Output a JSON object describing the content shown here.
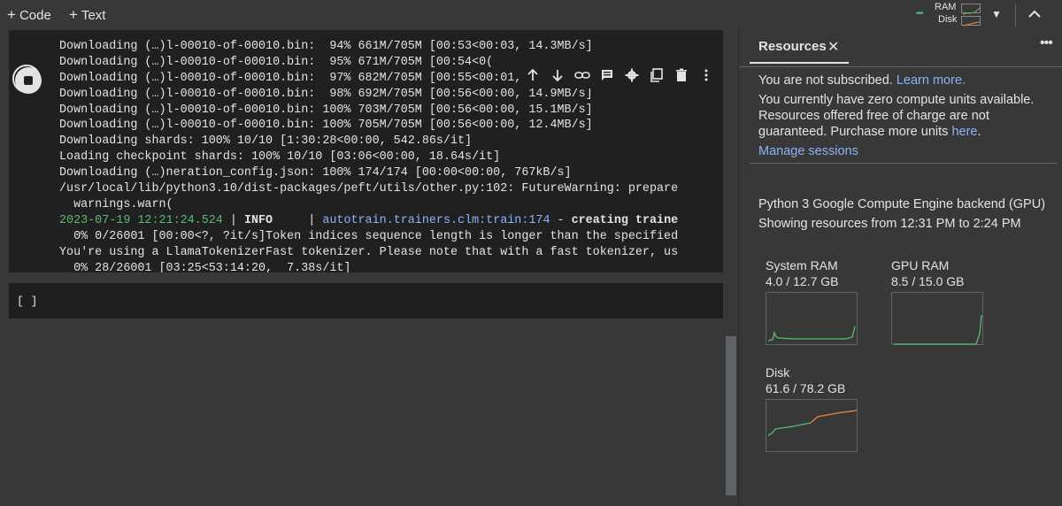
{
  "toolbar": {
    "code_label": "Code",
    "text_label": "Text",
    "ram_label": "RAM",
    "disk_label": "Disk"
  },
  "output": {
    "lines": [
      "Downloading (…)l-00010-of-00010.bin:  94% 661M/705M [00:53<00:03, 14.3MB/s]",
      "Downloading (…)l-00010-of-00010.bin:  95% 671M/705M [00:54<0(",
      "Downloading (…)l-00010-of-00010.bin:  97% 682M/705M [00:55<00:01, 14.4MB/s]",
      "Downloading (…)l-00010-of-00010.bin:  98% 692M/705M [00:56<00:00, 14.9MB/s]",
      "Downloading (…)l-00010-of-00010.bin: 100% 703M/705M [00:56<00:00, 15.1MB/s]",
      "Downloading (…)l-00010-of-00010.bin: 100% 705M/705M [00:56<00:00, 12.4MB/s]",
      "Downloading shards: 100% 10/10 [1:30:28<00:00, 542.86s/it]",
      "Loading checkpoint shards: 100% 10/10 [03:06<00:00, 18.64s/it]",
      "Downloading (…)neration_config.json: 100% 174/174 [00:00<00:00, 767kB/s]",
      "/usr/local/lib/python3.10/dist-packages/peft/utils/other.py:102: FutureWarning: prepare",
      "  warnings.warn("
    ],
    "log_ts": "2023-07-19 12:21:24.524",
    "log_sep1": " | ",
    "log_level": "INFO",
    "log_sep2": "     | ",
    "log_module": "autotrain.trainers.clm:train:174",
    "log_dash": " - ",
    "log_msg": "creating traine",
    "tail": [
      "  0% 0/26001 [00:00<?, ?it/s]Token indices sequence length is longer than the specified",
      "You're using a LlamaTokenizerFast tokenizer. Please note that with a fast tokenizer, us",
      "  0% 28/26001 [03:25<53:14:20,  7.38s/it]"
    ]
  },
  "empty_cell": {
    "brackets": "[ ]"
  },
  "panel": {
    "title": "Resources",
    "not_subscribed": "You are not subscribed.",
    "learn_more": "Learn more.",
    "zero_units_1": "You currently have zero compute units available.",
    "zero_units_2": "Resources offered free of charge are not",
    "zero_units_3": "guaranteed. Purchase more units",
    "here": "here",
    "manage_sessions": "Manage sessions",
    "backend": "Python 3 Google Compute Engine backend (GPU)",
    "showing": "Showing resources from 12:31 PM to 2:24 PM"
  },
  "metrics": {
    "system_ram": {
      "label": "System RAM",
      "value": "4.0 / 12.7 GB",
      "used": 4.0,
      "total": 12.7,
      "color": "#5bb974"
    },
    "gpu_ram": {
      "label": "GPU RAM",
      "value": "8.5 / 15.0 GB",
      "used": 8.5,
      "total": 15.0,
      "color": "#5bb974"
    },
    "disk": {
      "label": "Disk",
      "value": "61.6 / 78.2 GB",
      "used": 61.6,
      "total": 78.2,
      "color": "#5bb974",
      "accent": "#e8883a"
    }
  },
  "icons": [
    "plus-icon",
    "arrow-up-icon",
    "arrow-down-icon",
    "link-icon",
    "comment-icon",
    "gear-icon",
    "mirror-cell-icon",
    "trash-icon",
    "more-vert-icon",
    "close-icon",
    "chevron-down-icon",
    "chevron-up-icon",
    "stop-icon"
  ]
}
